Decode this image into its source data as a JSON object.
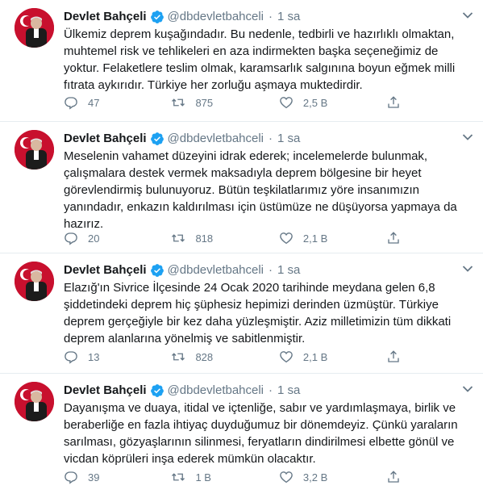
{
  "tweets": [
    {
      "name": "Devlet Bahçeli",
      "handle": "@dbdevletbahceli",
      "separator": "·",
      "time": "1 sa",
      "text": "Ülkemiz deprem kuşağındadır. Bu nedenle, tedbirli ve hazırlıklı olmaktan,\nmuhtemel risk ve tehlikeleri en aza indirmekten başka seçeneğimiz de\nyoktur. Felaketlere teslim olmak, karamsarlık salgınına boyun eğmek milli\nfıtrata aykırıdır. Türkiye her zorluğu aşmaya muktedirdir.",
      "replies": "47",
      "retweets": "875",
      "likes": "2,5 B"
    },
    {
      "name": "Devlet Bahçeli",
      "handle": "@dbdevletbahceli",
      "separator": "·",
      "time": "1 sa",
      "text": "Meselenin vahamet düzeyini idrak ederek; incelemelerde bulunmak,\nçalışmalara destek vermek maksadıyla deprem bölgesine bir heyet\ngörevlendirmiş bulunuyoruz. Bütün teşkilatlarımız yöre insanımızın\nyanındadır, enkazın kaldırılması için üstümüze ne düşüyorsa yapmaya da\nhazırız.",
      "replies": "20",
      "retweets": "818",
      "likes": "2,1 B"
    },
    {
      "name": "Devlet Bahçeli",
      "handle": "@dbdevletbahceli",
      "separator": "·",
      "time": "1 sa",
      "text": "Elazığ'ın Sivrice İlçesinde 24 Ocak 2020 tarihinde meydana gelen 6,8\nşiddetindeki deprem hiç şüphesiz hepimizi derinden üzmüştür. Türkiye\ndeprem gerçeğiyle bir kez daha yüzleşmiştir. Aziz milletimizin tüm dikkati\ndeprem alanlarına yönelmiş ve sabitlenmiştir.",
      "replies": "13",
      "retweets": "828",
      "likes": "2,1 B"
    },
    {
      "name": "Devlet Bahçeli",
      "handle": "@dbdevletbahceli",
      "separator": "·",
      "time": "1 sa",
      "text": "Dayanışma ve duaya, itidal ve içtenliğe, sabır ve yardımlaşmaya, birlik ve\nberaberliğe en fazla ihtiyaç duyduğumuz bir dönemdeyiz. Çünkü yaraların\nsarılması, gözyaşlarının silinmesi, feryatların dindirilmesi elbette gönül ve\nvicdan köprüleri inşa ederek mümkün olacaktır.",
      "replies": "39",
      "retweets": "1 B",
      "likes": "3,2 B"
    }
  ],
  "icons": {
    "avatar_background": "#c8102e",
    "verified": "verified-badge-icon",
    "caret": "chevron-down-icon",
    "reply": "reply-icon",
    "retweet": "retweet-icon",
    "like": "heart-icon",
    "share": "share-icon"
  },
  "colors": {
    "text": "#14171a",
    "secondary": "#657786",
    "verified": "#1da1f2",
    "divider": "#e6ecf0"
  }
}
